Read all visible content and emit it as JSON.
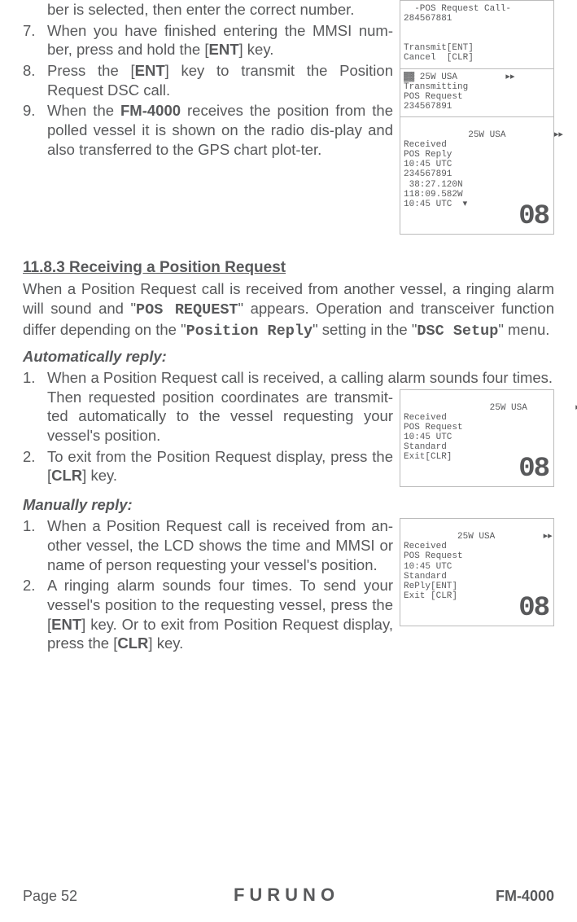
{
  "topSteps": {
    "lead": "ber is selected, then enter the correct number.",
    "s7": {
      "num": "7.",
      "text_a": "When you have finished entering the MMSI num-ber, press and hold the [",
      "key": "ENT",
      "text_b": "] key."
    },
    "s8": {
      "num": "8.",
      "text_a": "Press the [",
      "key": "ENT",
      "text_b": "] key to transmit the Position Request DSC call."
    },
    "s9": {
      "num": "9.",
      "text_a": "When the ",
      "bold": "FM-4000",
      "text_b": " receives the position from the polled vessel it is shown on the radio dis-play and also transferred to the GPS chart plot-ter."
    }
  },
  "lcdStack": {
    "box1": "  -POS Request Call-\n284567881\n\n\nTransmit[ENT]\nCancel  [CLR]",
    "box2": "▓▓ 25W USA         ▸▸\nTransmitting\nPOS Request\n234567891",
    "box3": "    25W USA         ▸▸\nReceived\nPOS Reply\n10:45 UTC\n234567891\n 38:27.120N\n118:09.582W\n10:45 UTC  ▾",
    "big3": "08"
  },
  "section": {
    "title": "11.8.3  Receiving a Position Request",
    "intro_a": "When a Position Request call is received from another vessel, a ringing alarm will sound and \"",
    "intro_b_lcd": "POS REQUEST",
    "intro_c": "\" appears. Operation and transceiver function differ depending on the \"",
    "intro_d_lcd": "Position Reply",
    "intro_e": "\" setting in the \"",
    "intro_f_lcd": "DSC Setup",
    "intro_g": "\" menu."
  },
  "auto": {
    "title": "Automatically reply:",
    "s1": {
      "num": "1.",
      "text": "When a Position Request call is received, a calling alarm sounds four times. Then requested position coordinates are transmit-ted automatically to the vessel requesting your vessel's position."
    },
    "s2": {
      "num": "2.",
      "text_a": "To exit from the Position Request display, press the [",
      "key": "CLR",
      "text_b": "] key."
    }
  },
  "lcdAuto": {
    "box": "    25W USA         ▸▸\nReceived\nPOS Request\n10:45 UTC\nStandard\nExit[CLR]",
    "big": "08"
  },
  "manual": {
    "title": "Manually reply:",
    "s1": {
      "num": "1.",
      "text": "When a Position Request call is received from an-other vessel, the LCD shows the time and MMSI or name of person requesting your vessel's position."
    },
    "s2": {
      "num": "2.",
      "text_a": "A ringing alarm sounds four times. To send your vessel's position to the requesting vessel, press the [",
      "key1": "ENT",
      "text_b": "] key. Or to exit from Position Request display, press the [",
      "key2": "CLR",
      "text_c": "] key."
    }
  },
  "lcdManual": {
    "box": "    25W USA         ▸▸\nReceived\nPOS Request\n10:45 UTC\nStandard\nRePly[ENT]\nExit [CLR]",
    "big": "08"
  },
  "footer": {
    "page": "Page 52",
    "brand": "FURUNO",
    "model": "FM-4000"
  }
}
